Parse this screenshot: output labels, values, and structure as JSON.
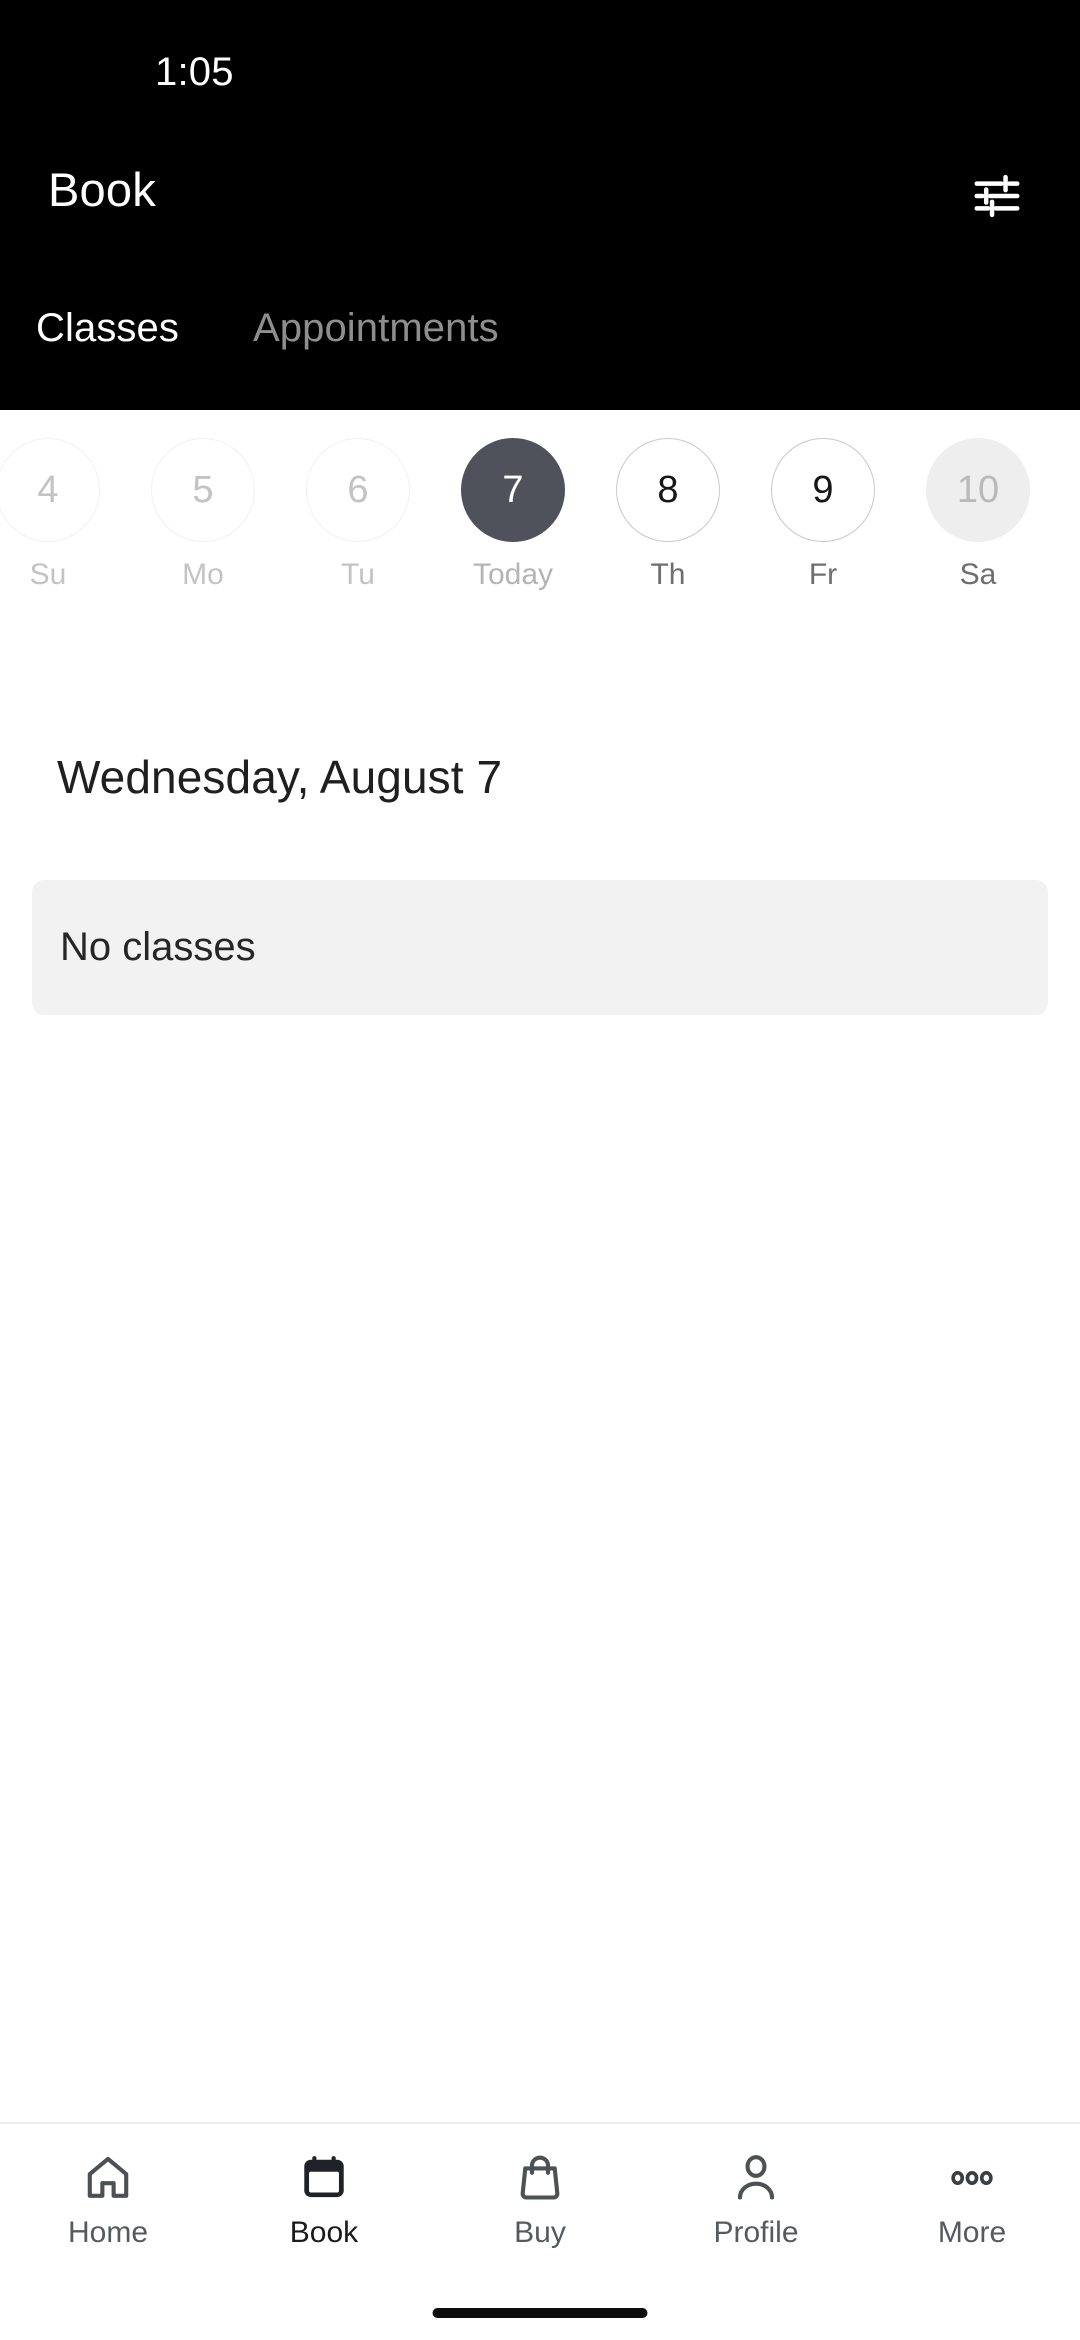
{
  "status_bar": {
    "time": "1:05"
  },
  "header": {
    "title": "Book",
    "filter_icon": "sliders-filter-icon",
    "background_color": "#000000",
    "tabs": [
      {
        "label": "Classes",
        "active": true
      },
      {
        "label": "Appointments",
        "active": false
      }
    ]
  },
  "date_strip": {
    "days": [
      {
        "number": "4",
        "label": "Su",
        "state": "past"
      },
      {
        "number": "5",
        "label": "Mo",
        "state": "past"
      },
      {
        "number": "6",
        "label": "Tu",
        "state": "past"
      },
      {
        "number": "7",
        "label": "Today",
        "state": "today"
      },
      {
        "number": "8",
        "label": "Th",
        "state": "future"
      },
      {
        "number": "9",
        "label": "Fr",
        "state": "future"
      },
      {
        "number": "10",
        "label": "Sa",
        "state": "highlight"
      }
    ],
    "selected_color": "#4f525b",
    "highlight_color": "#eeeeee"
  },
  "main": {
    "date_heading": "Wednesday, August 7",
    "empty_state_text": "No classes",
    "empty_state_bg": "#f2f2f2"
  },
  "bottom_nav": {
    "items": [
      {
        "label": "Home",
        "icon": "home-icon",
        "active": false
      },
      {
        "label": "Book",
        "icon": "calendar-icon",
        "active": true
      },
      {
        "label": "Buy",
        "icon": "shopping-bag-icon",
        "active": false
      },
      {
        "label": "Profile",
        "icon": "person-icon",
        "active": false
      },
      {
        "label": "More",
        "icon": "three-dots-icon",
        "active": false
      }
    ]
  }
}
